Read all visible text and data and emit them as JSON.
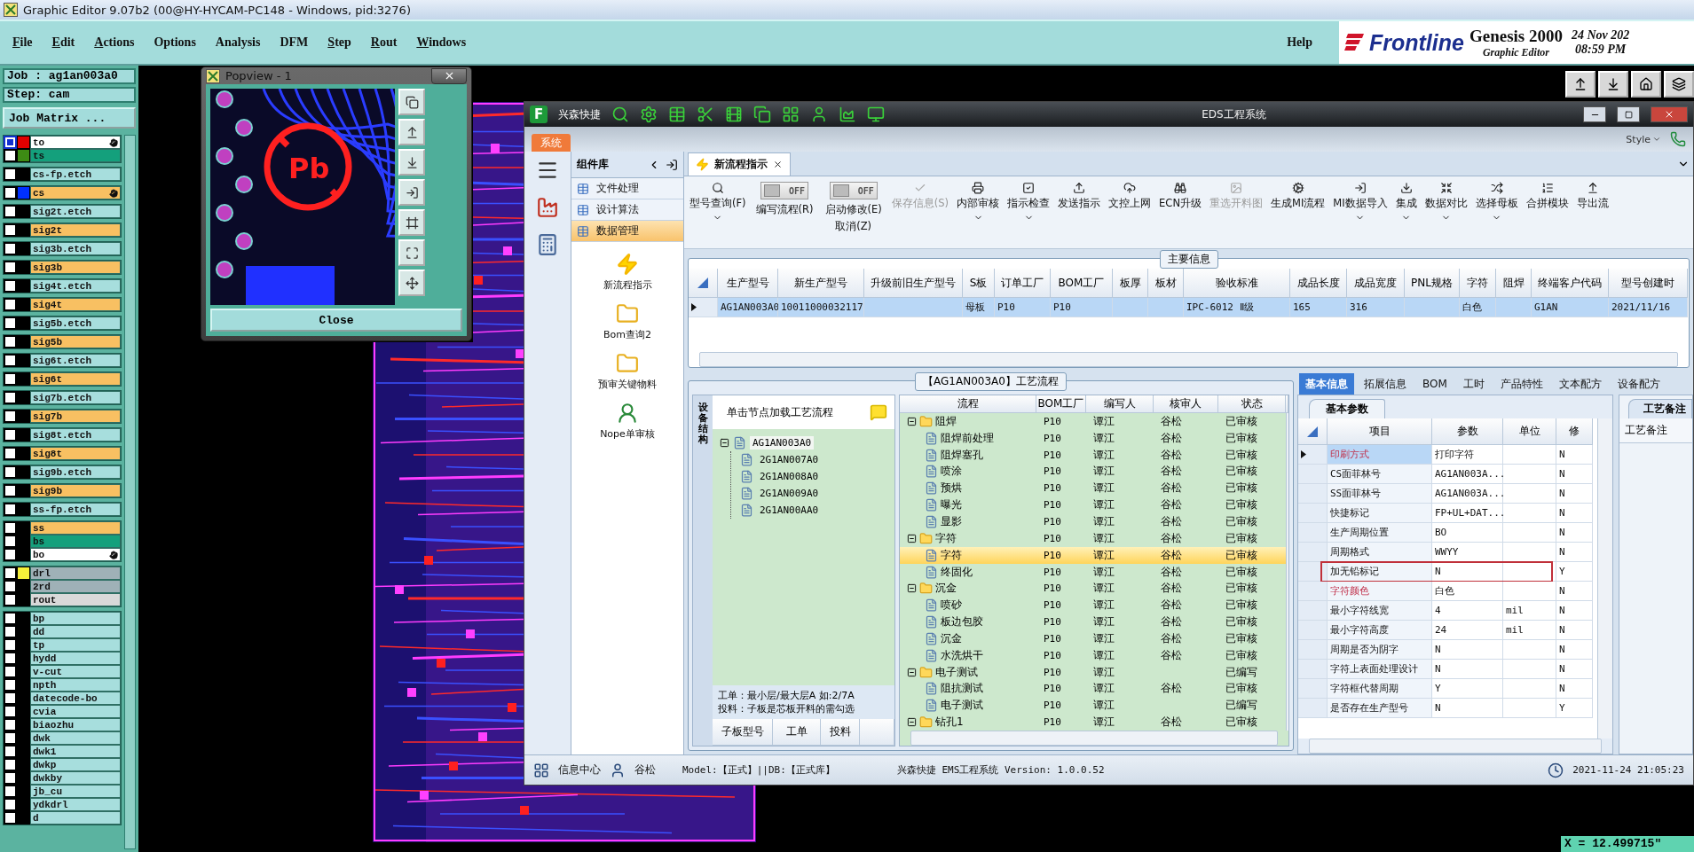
{
  "genesis": {
    "title": "Graphic Editor 9.07b2 (00@HY-HYCAM-PC148 - Windows, pid:3276)",
    "menus": [
      {
        "label": "File",
        "mnemonic": true
      },
      {
        "label": "Edit",
        "mnemonic": true
      },
      {
        "label": "Actions",
        "mnemonic": true
      },
      {
        "label": "Options",
        "mnemonic": false
      },
      {
        "label": "Analysis",
        "mnemonic": false
      },
      {
        "label": "DFM",
        "mnemonic": false
      },
      {
        "label": "Step",
        "mnemonic": true
      },
      {
        "label": "Rout",
        "mnemonic": true
      },
      {
        "label": "Windows",
        "mnemonic": true
      }
    ],
    "help": "Help",
    "brand": {
      "logo": "Frontline",
      "product": "Genesis 2000",
      "subtitle": "Graphic Editor",
      "date": "24 Nov 202",
      "time": "08:59 PM"
    },
    "job": "Job : ag1an003a0",
    "step": "Step: cam",
    "matrix_button": "Job Matrix ...",
    "layer_groups": [
      {
        "layers": [
          {
            "name": "to",
            "kind": "silk",
            "color": "#e00000",
            "selected": true,
            "affected": true
          },
          {
            "name": "ts",
            "kind": "mask",
            "color": "#3d8c14",
            "selected": false,
            "affected": false
          }
        ]
      },
      {
        "layers": [
          {
            "name": "cs-fp.etch",
            "kind": "etch",
            "color": "#000000",
            "selected": false,
            "affected": false
          }
        ]
      },
      {
        "layers": [
          {
            "name": "cs",
            "kind": "signal",
            "color": "#0030ff",
            "selected": false,
            "affected": true
          }
        ]
      },
      {
        "layers": [
          {
            "name": "sig2t.etch",
            "kind": "etch",
            "color": "#000000",
            "selected": false,
            "affected": false
          }
        ]
      },
      {
        "layers": [
          {
            "name": "sig2t",
            "kind": "signal",
            "color": "#000000",
            "selected": false,
            "affected": false
          }
        ]
      },
      {
        "layers": [
          {
            "name": "sig3b.etch",
            "kind": "etch",
            "color": "#000000",
            "selected": false,
            "affected": false
          }
        ]
      },
      {
        "layers": [
          {
            "name": "sig3b",
            "kind": "signal",
            "color": "#000000",
            "selected": false,
            "affected": false
          }
        ]
      },
      {
        "layers": [
          {
            "name": "sig4t.etch",
            "kind": "etch",
            "color": "#000000",
            "selected": false,
            "affected": false
          }
        ]
      },
      {
        "layers": [
          {
            "name": "sig4t",
            "kind": "signal",
            "color": "#000000",
            "selected": false,
            "affected": false
          }
        ]
      },
      {
        "layers": [
          {
            "name": "sig5b.etch",
            "kind": "etch",
            "color": "#000000",
            "selected": false,
            "affected": false
          }
        ]
      },
      {
        "layers": [
          {
            "name": "sig5b",
            "kind": "signal",
            "color": "#000000",
            "selected": false,
            "affected": false
          }
        ]
      },
      {
        "layers": [
          {
            "name": "sig6t.etch",
            "kind": "etch",
            "color": "#000000",
            "selected": false,
            "affected": false
          }
        ]
      },
      {
        "layers": [
          {
            "name": "sig6t",
            "kind": "signal",
            "color": "#000000",
            "selected": false,
            "affected": false
          }
        ]
      },
      {
        "layers": [
          {
            "name": "sig7b.etch",
            "kind": "etch",
            "color": "#000000",
            "selected": false,
            "affected": false
          }
        ]
      },
      {
        "layers": [
          {
            "name": "sig7b",
            "kind": "signal",
            "color": "#000000",
            "selected": false,
            "affected": false
          }
        ]
      },
      {
        "layers": [
          {
            "name": "sig8t.etch",
            "kind": "etch",
            "color": "#000000",
            "selected": false,
            "affected": false
          }
        ]
      },
      {
        "layers": [
          {
            "name": "sig8t",
            "kind": "signal",
            "color": "#000000",
            "selected": false,
            "affected": false
          }
        ]
      },
      {
        "layers": [
          {
            "name": "sig9b.etch",
            "kind": "etch",
            "color": "#000000",
            "selected": false,
            "affected": false
          }
        ]
      },
      {
        "layers": [
          {
            "name": "sig9b",
            "kind": "signal",
            "color": "#000000",
            "selected": false,
            "affected": false
          }
        ]
      },
      {
        "layers": [
          {
            "name": "ss-fp.etch",
            "kind": "etch",
            "color": "#000000",
            "selected": false,
            "affected": false
          }
        ]
      },
      {
        "layers": [
          {
            "name": "ss",
            "kind": "signal",
            "color": "#000000",
            "selected": false,
            "affected": false
          },
          {
            "name": "bs",
            "kind": "mask",
            "color": "#000000",
            "selected": false,
            "affected": false
          },
          {
            "name": "bo",
            "kind": "silk",
            "color": "#000000",
            "selected": false,
            "affected": true
          }
        ]
      },
      {
        "layers": [
          {
            "name": "drl",
            "kind": "drill",
            "color": "#f5f03a",
            "selected": false,
            "affected": false
          },
          {
            "name": "2rd",
            "kind": "drill",
            "color": "#000000",
            "selected": false,
            "affected": false
          },
          {
            "name": "rout",
            "kind": "rout",
            "color": "#000000",
            "selected": false,
            "affected": false
          }
        ]
      },
      {
        "layers": [
          {
            "name": "bp",
            "kind": "doc",
            "color": "#000000",
            "selected": false,
            "affected": false
          },
          {
            "name": "dd",
            "kind": "doc",
            "color": "#000000",
            "selected": false,
            "affected": false
          },
          {
            "name": "tp",
            "kind": "doc",
            "color": "#000000",
            "selected": false,
            "affected": false
          },
          {
            "name": "hydd",
            "kind": "doc",
            "color": "#000000",
            "selected": false,
            "affected": false
          },
          {
            "name": "v-cut",
            "kind": "doc",
            "color": "#000000",
            "selected": false,
            "affected": false
          },
          {
            "name": "npth",
            "kind": "doc",
            "color": "#000000",
            "selected": false,
            "affected": false
          },
          {
            "name": "datecode-bo",
            "kind": "doc",
            "color": "#000000",
            "selected": false,
            "affected": false
          },
          {
            "name": "cvia",
            "kind": "doc",
            "color": "#000000",
            "selected": false,
            "affected": false
          },
          {
            "name": "biaozhu",
            "kind": "doc",
            "color": "#000000",
            "selected": false,
            "affected": false
          },
          {
            "name": "dwk",
            "kind": "doc",
            "color": "#000000",
            "selected": false,
            "affected": false
          },
          {
            "name": "dwk1",
            "kind": "doc",
            "color": "#000000",
            "selected": false,
            "affected": false
          },
          {
            "name": "dwkp",
            "kind": "doc",
            "color": "#000000",
            "selected": false,
            "affected": false
          },
          {
            "name": "dwkby",
            "kind": "doc",
            "color": "#000000",
            "selected": false,
            "affected": false
          },
          {
            "name": "jb_cu",
            "kind": "doc",
            "color": "#000000",
            "selected": false,
            "affected": false
          },
          {
            "name": "ydkdrl",
            "kind": "doc",
            "color": "#000000",
            "selected": false,
            "affected": false
          },
          {
            "name": "d",
            "kind": "doc",
            "color": "#000000",
            "selected": false,
            "affected": false
          }
        ]
      }
    ],
    "coordinate": "X = 12.499715\""
  },
  "popview": {
    "title": "Popview - 1",
    "lead_free_mark": "Pb",
    "close_button": "Close"
  },
  "eds": {
    "logo": "F",
    "app_name": "兴森快捷",
    "title": "EDS工程系统",
    "system_tab": "系统",
    "style_label": "Style",
    "sidebar": {
      "header": "组件库",
      "categories": [
        {
          "label": "文件处理",
          "selected": false
        },
        {
          "label": "设计算法",
          "selected": false
        },
        {
          "label": "数据管理",
          "selected": true
        }
      ],
      "tools": [
        "新流程指示",
        "Bom查询2",
        "预审关键物料",
        "Nope单审核"
      ]
    },
    "doc_tab": {
      "label": "新流程指示",
      "selected": true
    },
    "toolbar": [
      {
        "kind": "button",
        "label": "型号查询(F)",
        "disabled": false,
        "menu": true
      },
      {
        "kind": "toggle",
        "label": "编写流程(R)",
        "toggle_text": "OFF",
        "on": false
      },
      {
        "kind": "toggle",
        "label": "启动修改(E)",
        "sublabel": "取消(Z)",
        "toggle_text": "OFF",
        "on": false
      },
      {
        "kind": "button",
        "label": "保存信息(S)",
        "disabled": true,
        "menu": false
      },
      {
        "kind": "button",
        "label": "内部审核",
        "disabled": false,
        "menu": true
      },
      {
        "kind": "button",
        "label": "指示检查",
        "disabled": false,
        "menu": true
      },
      {
        "kind": "button",
        "label": "发送指示",
        "disabled": false,
        "menu": false
      },
      {
        "kind": "button",
        "label": "文控上网",
        "disabled": false,
        "menu": false
      },
      {
        "kind": "button",
        "label": "ECN升级",
        "disabled": false,
        "menu": false
      },
      {
        "kind": "button",
        "label": "重选开料图",
        "disabled": true,
        "menu": false
      },
      {
        "kind": "button",
        "label": "生成MI流程",
        "disabled": false,
        "menu": false
      },
      {
        "kind": "button",
        "label": "MI数据导入",
        "disabled": false,
        "menu": true
      },
      {
        "kind": "button",
        "label": "集成",
        "disabled": false,
        "menu": true
      },
      {
        "kind": "button",
        "label": "数据对比",
        "disabled": false,
        "menu": true
      },
      {
        "kind": "button",
        "label": "选择母板",
        "disabled": false,
        "menu": true
      },
      {
        "kind": "button",
        "label": "合拼模块",
        "disabled": false,
        "menu": false
      },
      {
        "kind": "button",
        "label": "导出流",
        "disabled": false,
        "menu": false
      }
    ],
    "main_info": {
      "title": "主要信息",
      "columns": [
        "生产型号",
        "新生产型号",
        "升级前旧生产型号",
        "S板",
        "订单工厂",
        "BOM工厂",
        "板厚",
        "板材",
        "验收标准",
        "成品长度",
        "成品宽度",
        "PNL规格",
        "字符",
        "阻焊",
        "终端客户代码",
        "型号创建时"
      ],
      "rows": [
        {
          "selected": true,
          "cells": [
            "AG1AN003A0",
            "10011000032117",
            null,
            "母板",
            "P10",
            "P10",
            null,
            null,
            "IPC-6012 Ⅱ级",
            "165",
            "316",
            null,
            "白色",
            null,
            "G1AN",
            "2021/11/16"
          ]
        }
      ]
    },
    "process": {
      "title": "【AG1AN003A0】工艺流程",
      "side_tab": "设备结构",
      "hint": "单击节点加载工艺流程",
      "tree": {
        "label": "AG1AN003A0",
        "expanded": true,
        "children": [
          {
            "label": "2G1AN007A0"
          },
          {
            "label": "2G1AN008A0"
          },
          {
            "label": "2G1AN009A0"
          },
          {
            "label": "2G1AN00AA0"
          }
        ]
      },
      "notes": [
        "工单：最小层/最大层A 如:2/7A",
        "投料：子板是芯板开料的需勾选"
      ],
      "sub_columns": [
        "子板型号",
        "工单",
        "投料"
      ],
      "columns": [
        "流程",
        "BOM工厂",
        "编写人",
        "核审人",
        "状态"
      ],
      "steps": [
        {
          "kind": "folder",
          "name": "阻焊",
          "factory": "P10",
          "writer": "谭江",
          "reviewer": "谷松",
          "status": "已审核",
          "selected": false,
          "expanded": true,
          "children": [
            {
              "name": "阻焊前处理",
              "factory": "P10",
              "writer": "谭江",
              "reviewer": "谷松",
              "status": "已审核",
              "selected": false
            },
            {
              "name": "阻焊塞孔",
              "factory": "P10",
              "writer": "谭江",
              "reviewer": "谷松",
              "status": "已审核",
              "selected": false
            },
            {
              "name": "喷涂",
              "factory": "P10",
              "writer": "谭江",
              "reviewer": "谷松",
              "status": "已审核",
              "selected": false
            },
            {
              "name": "预烘",
              "factory": "P10",
              "writer": "谭江",
              "reviewer": "谷松",
              "status": "已审核",
              "selected": false
            },
            {
              "name": "曝光",
              "factory": "P10",
              "writer": "谭江",
              "reviewer": "谷松",
              "status": "已审核",
              "selected": false
            },
            {
              "name": "显影",
              "factory": "P10",
              "writer": "谭江",
              "reviewer": "谷松",
              "status": "已审核",
              "selected": false
            }
          ]
        },
        {
          "kind": "folder",
          "name": "字符",
          "factory": "P10",
          "writer": "谭江",
          "reviewer": "谷松",
          "status": "已审核",
          "selected": false,
          "expanded": true,
          "children": [
            {
              "name": "字符",
              "factory": "P10",
              "writer": "谭江",
              "reviewer": "谷松",
              "status": "已审核",
              "selected": true
            },
            {
              "name": "终固化",
              "factory": "P10",
              "writer": "谭江",
              "reviewer": "谷松",
              "status": "已审核",
              "selected": false
            }
          ]
        },
        {
          "kind": "folder",
          "name": "沉金",
          "factory": "P10",
          "writer": "谭江",
          "reviewer": "谷松",
          "status": "已审核",
          "selected": false,
          "expanded": true,
          "children": [
            {
              "name": "喷砂",
              "factory": "P10",
              "writer": "谭江",
              "reviewer": "谷松",
              "status": "已审核",
              "selected": false
            },
            {
              "name": "板边包胶",
              "factory": "P10",
              "writer": "谭江",
              "reviewer": "谷松",
              "status": "已审核",
              "selected": false
            },
            {
              "name": "沉金",
              "factory": "P10",
              "writer": "谭江",
              "reviewer": "谷松",
              "status": "已审核",
              "selected": false
            },
            {
              "name": "水洗烘干",
              "factory": "P10",
              "writer": "谭江",
              "reviewer": "谷松",
              "status": "已审核",
              "selected": false
            }
          ]
        },
        {
          "kind": "folder",
          "name": "电子测试",
          "factory": "P10",
          "writer": "谭江",
          "status": "已编写",
          "selected": false,
          "expanded": true,
          "children": [
            {
              "name": "阻抗测试",
              "factory": "P10",
              "writer": "谭江",
              "reviewer": "谷松",
              "status": "已审核",
              "selected": false
            },
            {
              "name": "电子测试",
              "factory": "P10",
              "writer": "谭江",
              "status": "已编写",
              "selected": false
            }
          ]
        },
        {
          "kind": "folder",
          "name": "钻孔1",
          "factory": "P10",
          "writer": "谭江",
          "reviewer": "谷松",
          "status": "已审核",
          "selected": false,
          "expanded": true
        }
      ]
    },
    "details": {
      "tabs": [
        {
          "label": "基本信息",
          "selected": true
        },
        {
          "label": "拓展信息",
          "selected": false
        },
        {
          "label": "BOM",
          "selected": false
        },
        {
          "label": "工时",
          "selected": false
        },
        {
          "label": "产品特性",
          "selected": false
        },
        {
          "label": "文本配方",
          "selected": false
        },
        {
          "label": "设备配方",
          "selected": false
        }
      ],
      "subtab": "基本参数",
      "columns": [
        "项目",
        "参数",
        "单位",
        "修"
      ],
      "rows": [
        {
          "item": "印刷方式",
          "value": "打印字符",
          "modified": "N",
          "selected": true,
          "flagged": true,
          "outlined": false
        },
        {
          "item": "CS面菲林号",
          "value": "AG1AN003A...",
          "modified": "N",
          "selected": false,
          "flagged": false,
          "outlined": false
        },
        {
          "item": "SS面菲林号",
          "value": "AG1AN003A...",
          "modified": "N",
          "selected": false,
          "flagged": false,
          "outlined": false
        },
        {
          "item": "快捷标记",
          "value": "FP+UL+DAT...",
          "modified": "N",
          "selected": false,
          "flagged": false,
          "outlined": false
        },
        {
          "item": "生产周期位置",
          "value": "BO",
          "modified": "N",
          "selected": false,
          "flagged": false,
          "outlined": false
        },
        {
          "item": "周期格式",
          "value": "WWYY",
          "modified": "N",
          "selected": false,
          "flagged": false,
          "outlined": false
        },
        {
          "item": "加无铅标记",
          "value": "N",
          "modified": "Y",
          "selected": false,
          "flagged": false,
          "outlined": true
        },
        {
          "item": "字符颜色",
          "value": "白色",
          "modified": "N",
          "selected": false,
          "flagged": true,
          "outlined": false
        },
        {
          "item": "最小字符线宽",
          "value": "4",
          "unit": "mil",
          "modified": "N",
          "selected": false,
          "flagged": false,
          "outlined": false
        },
        {
          "item": "最小字符高度",
          "value": "24",
          "unit": "mil",
          "modified": "N",
          "selected": false,
          "flagged": false,
          "outlined": false
        },
        {
          "item": "周期是否为阴字",
          "value": "N",
          "modified": "N",
          "selected": false,
          "flagged": false,
          "outlined": false
        },
        {
          "item": "字符上表面处理设计",
          "value": "N",
          "modified": "N",
          "selected": false,
          "flagged": false,
          "outlined": false
        },
        {
          "item": "字符框代替周期",
          "value": "Y",
          "modified": "N",
          "selected": false,
          "flagged": false,
          "outlined": false
        },
        {
          "item": "是否存在生产型号",
          "value": "N",
          "modified": "Y",
          "selected": false,
          "flagged": false,
          "outlined": false
        }
      ],
      "notes_tab": "工艺备注",
      "notes_header": "工艺备注"
    },
    "status": {
      "info_center": "信息中心",
      "user": "谷松",
      "model": "Model:【正式】||DB:【正式库】",
      "version": "兴森快捷 EMS工程系统 Version: 1.0.0.52",
      "datetime": "2021-11-24 21:05:23"
    }
  }
}
